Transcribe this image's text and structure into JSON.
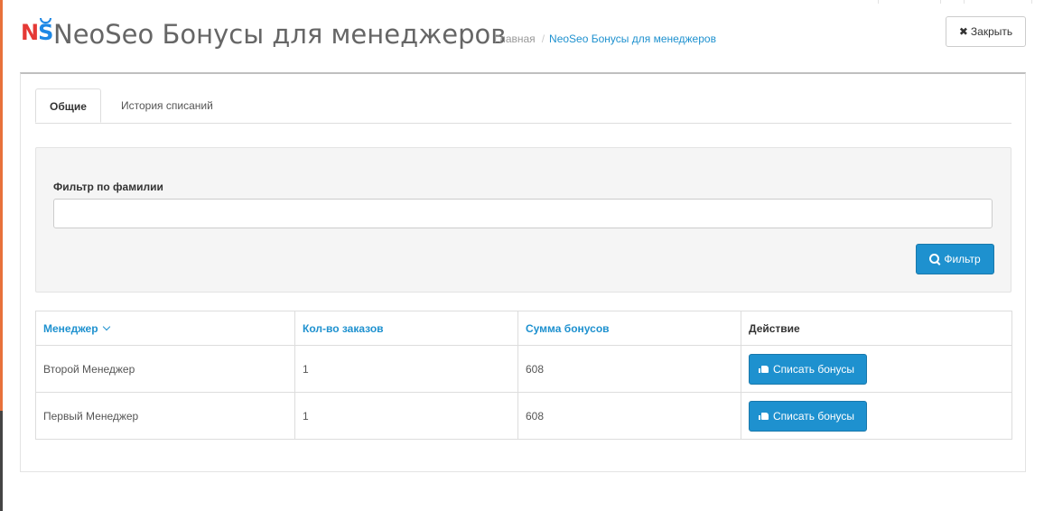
{
  "header": {
    "logo": {
      "letter1": "N",
      "letter2": "S"
    },
    "title": "NeoSeo Бонусы для менеджеров",
    "breadcrumb": {
      "home": "Главная",
      "separator": "/",
      "current": "NeoSeo Бонусы для менеджеров"
    },
    "close_button": {
      "icon": "close-icon",
      "label": "Закрыть"
    }
  },
  "tabs": [
    {
      "label": "Общие",
      "active": true
    },
    {
      "label": "История списаний",
      "active": false
    }
  ],
  "filter": {
    "label": "Фильтр по фамилии",
    "value": "",
    "button": {
      "icon": "search-icon",
      "label": "Фильтр"
    }
  },
  "table": {
    "columns": [
      {
        "label": "Менеджер",
        "sortable": true,
        "sort_icon": "chevron-down-icon"
      },
      {
        "label": "Кол-во заказов",
        "sortable": true
      },
      {
        "label": "Сумма бонусов",
        "sortable": true
      },
      {
        "label": "Действие",
        "sortable": false
      }
    ],
    "rows": [
      {
        "manager": "Второй Менеджер",
        "orders": "1",
        "bonus": "608",
        "action_label": "Списать бонусы",
        "action_icon": "thumbs-up-icon"
      },
      {
        "manager": "Первый Менеджер",
        "orders": "1",
        "bonus": "608",
        "action_label": "Списать бонусы",
        "action_icon": "thumbs-up-icon"
      }
    ]
  },
  "colors": {
    "primary": "#1e91cf",
    "logo_red": "#e53935",
    "logo_blue": "#1e88e5",
    "left_accent": "#e8713b"
  }
}
